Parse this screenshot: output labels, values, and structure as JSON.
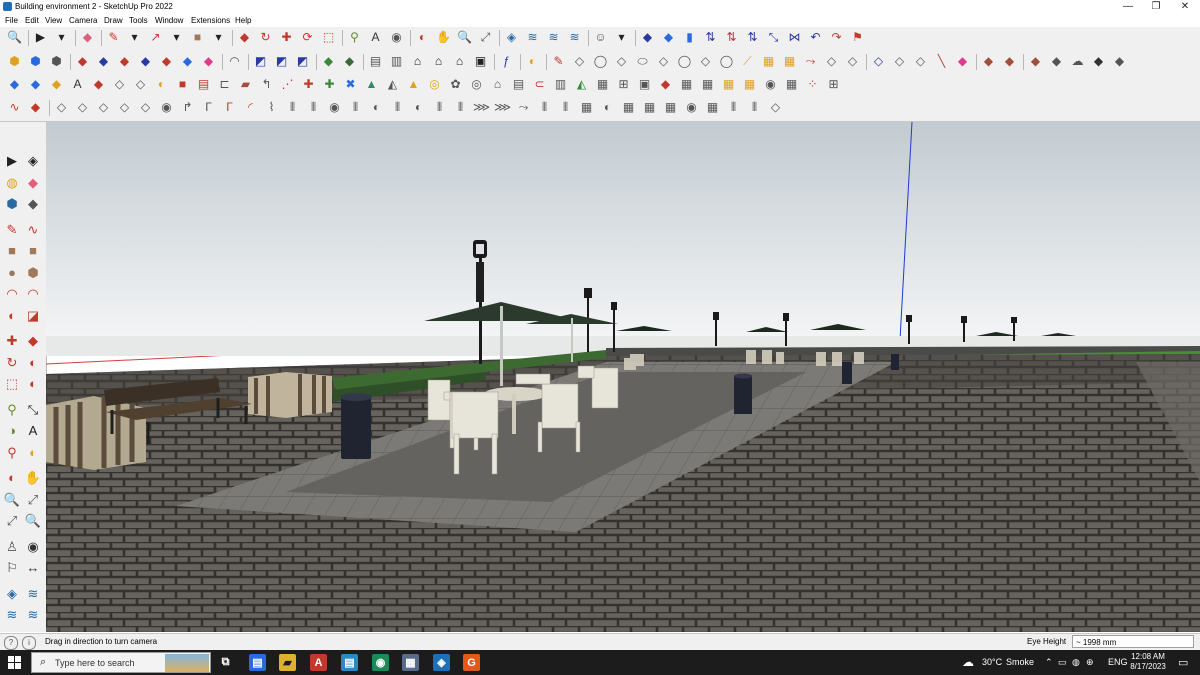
{
  "window": {
    "title": "Building environment 2 - SketchUp Pro 2022",
    "minimize": "—",
    "restore": "❐",
    "close": "✕"
  },
  "menu": [
    "File",
    "Edit",
    "View",
    "Camera",
    "Draw",
    "Tools",
    "Window",
    "Extensions",
    "Help"
  ],
  "status": {
    "hint": "Drag in direction to turn camera",
    "eye_height_label": "Eye Height",
    "eye_height_value": "~ 1998 mm"
  },
  "taskbar": {
    "search_placeholder": "Type here to search",
    "weather_temp": "30°C",
    "weather_desc": "Smoke",
    "lang": "ENG",
    "time": "12:08 AM",
    "date": "8/17/2023"
  },
  "toolbar_rows": [
    [
      {
        "glyph": "🔍",
        "color": "#3a3a3a"
      },
      {
        "sep": true
      },
      {
        "glyph": "▶",
        "color": "#222"
      },
      {
        "glyph": "▾",
        "color": "#222"
      },
      {
        "sep": true
      },
      {
        "glyph": "◆",
        "color": "#e0607a"
      },
      {
        "sep": true
      },
      {
        "glyph": "✎",
        "color": "#c83a2a"
      },
      {
        "glyph": "▾",
        "color": "#222"
      },
      {
        "glyph": "↗",
        "color": "#c83a2a"
      },
      {
        "glyph": "▾",
        "color": "#222"
      },
      {
        "glyph": "■",
        "color": "#a0785a"
      },
      {
        "glyph": "▾",
        "color": "#222"
      },
      {
        "sep": true
      },
      {
        "glyph": "◆",
        "color": "#c0392b"
      },
      {
        "glyph": "↻",
        "color": "#c0392b"
      },
      {
        "glyph": "✚",
        "color": "#c0392b"
      },
      {
        "glyph": "⟳",
        "color": "#c0392b"
      },
      {
        "glyph": "⬚",
        "color": "#c0392b"
      },
      {
        "sep": true
      },
      {
        "glyph": "⚲",
        "color": "#6a8a30"
      },
      {
        "glyph": "A",
        "color": "#333"
      },
      {
        "glyph": "◉",
        "color": "#555"
      },
      {
        "sep": true
      },
      {
        "glyph": "◐",
        "color": "#c0392b"
      },
      {
        "glyph": "✋",
        "color": "#555"
      },
      {
        "glyph": "🔍",
        "color": "#555"
      },
      {
        "glyph": "⤢",
        "color": "#555"
      },
      {
        "sep": true
      },
      {
        "glyph": "◈",
        "color": "#2a6aa0"
      },
      {
        "glyph": "≋",
        "color": "#2a6aa0"
      },
      {
        "glyph": "≋",
        "color": "#2a6aa0"
      },
      {
        "glyph": "≋",
        "color": "#2a6aa0"
      },
      {
        "sep": true
      },
      {
        "glyph": "☺",
        "color": "#555"
      },
      {
        "glyph": "▾",
        "color": "#222"
      },
      {
        "sep": true
      },
      {
        "glyph": "◆",
        "color": "#2a3aa0"
      },
      {
        "glyph": "◆",
        "color": "#2a6ae0"
      },
      {
        "glyph": "▮",
        "color": "#2a6ae0"
      },
      {
        "glyph": "⇅",
        "color": "#2a3aa0"
      },
      {
        "glyph": "⇅",
        "color": "#c0392b"
      },
      {
        "glyph": "⇅",
        "color": "#2a3aa0"
      },
      {
        "glyph": "⤡",
        "color": "#2a3aa0"
      },
      {
        "glyph": "⋈",
        "color": "#2a3aa0"
      },
      {
        "glyph": "↶",
        "color": "#2a3aa0"
      },
      {
        "glyph": "↷",
        "color": "#c0392b"
      },
      {
        "glyph": "⚑",
        "color": "#c0392b"
      }
    ],
    [
      {
        "glyph": "⬢",
        "color": "#e0a020"
      },
      {
        "glyph": "⬢",
        "color": "#2a6ae0"
      },
      {
        "glyph": "⬢",
        "color": "#555"
      },
      {
        "sep": true
      },
      {
        "glyph": "◆",
        "color": "#c0392b"
      },
      {
        "glyph": "◆",
        "color": "#2a3aa0"
      },
      {
        "glyph": "◆",
        "color": "#c0392b"
      },
      {
        "glyph": "◆",
        "color": "#2a3aa0"
      },
      {
        "glyph": "◆",
        "color": "#c0392b"
      },
      {
        "glyph": "◆",
        "color": "#2a6ae0"
      },
      {
        "glyph": "◆",
        "color": "#e03a8a"
      },
      {
        "sep": true
      },
      {
        "glyph": "◠",
        "color": "#555"
      },
      {
        "sep": true
      },
      {
        "glyph": "◩",
        "color": "#2a3aa0"
      },
      {
        "glyph": "◩",
        "color": "#2a3aa0"
      },
      {
        "glyph": "◩",
        "color": "#2a3aa0"
      },
      {
        "sep": true
      },
      {
        "glyph": "◆",
        "color": "#3a8a3a"
      },
      {
        "glyph": "◆",
        "color": "#3a6a3a"
      },
      {
        "sep": true
      },
      {
        "glyph": "▤",
        "color": "#555"
      },
      {
        "glyph": "▥",
        "color": "#555"
      },
      {
        "glyph": "⌂",
        "color": "#222"
      },
      {
        "glyph": "⌂",
        "color": "#222"
      },
      {
        "glyph": "⌂",
        "color": "#222"
      },
      {
        "glyph": "▣",
        "color": "#222"
      },
      {
        "sep": true
      },
      {
        "glyph": "ƒ",
        "color": "#2a3aa0"
      },
      {
        "sep": true
      },
      {
        "glyph": "◐",
        "color": "#e0a020"
      },
      {
        "sep": true
      },
      {
        "glyph": "✎",
        "color": "#c0392b"
      },
      {
        "glyph": "◇",
        "color": "#555"
      },
      {
        "glyph": "◯",
        "color": "#555"
      },
      {
        "glyph": "◇",
        "color": "#555"
      },
      {
        "glyph": "⬭",
        "color": "#555"
      },
      {
        "glyph": "◇",
        "color": "#555"
      },
      {
        "glyph": "◯",
        "color": "#555"
      },
      {
        "glyph": "◇",
        "color": "#555"
      },
      {
        "glyph": "◯",
        "color": "#555"
      },
      {
        "glyph": "⟋",
        "color": "#e0a020"
      },
      {
        "glyph": "▦",
        "color": "#e0a020"
      },
      {
        "glyph": "▦",
        "color": "#e0a020"
      },
      {
        "glyph": "⤳",
        "color": "#c0392b"
      },
      {
        "glyph": "◇",
        "color": "#555"
      },
      {
        "glyph": "◇",
        "color": "#555"
      },
      {
        "sep": true
      },
      {
        "glyph": "◇",
        "color": "#2a3aa0"
      },
      {
        "glyph": "◇",
        "color": "#555"
      },
      {
        "glyph": "◇",
        "color": "#555"
      },
      {
        "glyph": "╲",
        "color": "#c0392b"
      },
      {
        "glyph": "◆",
        "color": "#e03a8a"
      },
      {
        "sep": true
      },
      {
        "glyph": "◆",
        "color": "#a0503a"
      },
      {
        "glyph": "◆",
        "color": "#a0503a"
      },
      {
        "sep": true
      },
      {
        "glyph": "◆",
        "color": "#a0503a"
      },
      {
        "glyph": "◆",
        "color": "#555"
      },
      {
        "glyph": "☁",
        "color": "#555"
      },
      {
        "glyph": "◆",
        "color": "#333"
      },
      {
        "glyph": "◆",
        "color": "#555"
      }
    ],
    [
      {
        "glyph": "◆",
        "color": "#2a6ae0"
      },
      {
        "glyph": "◆",
        "color": "#2a6ae0"
      },
      {
        "glyph": "◆",
        "color": "#e0a020"
      },
      {
        "glyph": "A",
        "color": "#333"
      },
      {
        "glyph": "◆",
        "color": "#c0392b"
      },
      {
        "glyph": "◇",
        "color": "#555"
      },
      {
        "glyph": "◇",
        "color": "#555"
      },
      {
        "glyph": "◐",
        "color": "#e0a020"
      },
      {
        "glyph": "■",
        "color": "#c0392b"
      },
      {
        "glyph": "▤",
        "color": "#c0392b"
      },
      {
        "glyph": "⊏",
        "color": "#555"
      },
      {
        "glyph": "▰",
        "color": "#a0503a"
      },
      {
        "glyph": "↰",
        "color": "#555"
      },
      {
        "glyph": "⋰",
        "color": "#c0392b"
      },
      {
        "glyph": "✚",
        "color": "#c0392b"
      },
      {
        "glyph": "✚",
        "color": "#3a8a3a"
      },
      {
        "glyph": "✖",
        "color": "#2a6ae0"
      },
      {
        "glyph": "▲",
        "color": "#2a8a6a"
      },
      {
        "glyph": "◭",
        "color": "#555"
      },
      {
        "glyph": "▲",
        "color": "#e0a020"
      },
      {
        "glyph": "◎",
        "color": "#e0a020"
      },
      {
        "glyph": "✿",
        "color": "#555"
      },
      {
        "glyph": "◎",
        "color": "#555"
      },
      {
        "glyph": "⌂",
        "color": "#555"
      },
      {
        "glyph": "▤",
        "color": "#555"
      },
      {
        "glyph": "⊂",
        "color": "#c0392b"
      },
      {
        "glyph": "▥",
        "color": "#555"
      },
      {
        "glyph": "◭",
        "color": "#3a8a3a"
      },
      {
        "glyph": "▦",
        "color": "#555"
      },
      {
        "glyph": "⊞",
        "color": "#555"
      },
      {
        "glyph": "▣",
        "color": "#555"
      },
      {
        "glyph": "◆",
        "color": "#c0392b"
      },
      {
        "glyph": "▦",
        "color": "#555"
      },
      {
        "glyph": "▦",
        "color": "#555"
      },
      {
        "glyph": "▦",
        "color": "#e0a020"
      },
      {
        "glyph": "▦",
        "color": "#e0a020"
      },
      {
        "glyph": "◉",
        "color": "#555"
      },
      {
        "glyph": "▦",
        "color": "#555"
      },
      {
        "glyph": "⁘",
        "color": "#c0392b"
      },
      {
        "glyph": "⊞",
        "color": "#555"
      }
    ],
    [
      {
        "glyph": "∿",
        "color": "#c0392b"
      },
      {
        "glyph": "◆",
        "color": "#c0392b"
      },
      {
        "sep": true
      },
      {
        "glyph": "◇",
        "color": "#555"
      },
      {
        "glyph": "◇",
        "color": "#555"
      },
      {
        "glyph": "◇",
        "color": "#555"
      },
      {
        "glyph": "◇",
        "color": "#555"
      },
      {
        "glyph": "◇",
        "color": "#555"
      },
      {
        "glyph": "◉",
        "color": "#555"
      },
      {
        "glyph": "↱",
        "color": "#555"
      },
      {
        "glyph": "Γ",
        "color": "#555"
      },
      {
        "glyph": "Γ",
        "color": "#c0392b"
      },
      {
        "glyph": "◜",
        "color": "#c0392b"
      },
      {
        "glyph": "⌇",
        "color": "#555"
      },
      {
        "glyph": "⫴",
        "color": "#555"
      },
      {
        "glyph": "⫴",
        "color": "#555"
      },
      {
        "glyph": "◉",
        "color": "#555"
      },
      {
        "glyph": "⫴",
        "color": "#555"
      },
      {
        "glyph": "◐",
        "color": "#555"
      },
      {
        "glyph": "⫴",
        "color": "#555"
      },
      {
        "glyph": "◐",
        "color": "#555"
      },
      {
        "glyph": "⫴",
        "color": "#555"
      },
      {
        "glyph": "⫴",
        "color": "#555"
      },
      {
        "glyph": "⋙",
        "color": "#555"
      },
      {
        "glyph": "⋙",
        "color": "#555"
      },
      {
        "glyph": "⤳",
        "color": "#555"
      },
      {
        "glyph": "⫴",
        "color": "#555"
      },
      {
        "glyph": "⫴",
        "color": "#555"
      },
      {
        "glyph": "▦",
        "color": "#555"
      },
      {
        "glyph": "◐",
        "color": "#555"
      },
      {
        "glyph": "▦",
        "color": "#555"
      },
      {
        "glyph": "▦",
        "color": "#555"
      },
      {
        "glyph": "▦",
        "color": "#555"
      },
      {
        "glyph": "◉",
        "color": "#555"
      },
      {
        "glyph": "▦",
        "color": "#555"
      },
      {
        "glyph": "⫴",
        "color": "#555"
      },
      {
        "glyph": "⫴",
        "color": "#555"
      },
      {
        "glyph": "◇",
        "color": "#555"
      }
    ]
  ],
  "left_tools": [
    [
      {
        "glyph": "▶",
        "color": "#222"
      },
      {
        "glyph": "◈",
        "color": "#222"
      }
    ],
    [
      {
        "glyph": "◍",
        "color": "#e0a020"
      },
      {
        "glyph": "◆",
        "color": "#e0607a"
      }
    ],
    [
      {
        "glyph": "⬢",
        "color": "#2a6aa0"
      },
      {
        "glyph": "◆",
        "color": "#555"
      }
    ],
    [
      {
        "glyph": "✎",
        "color": "#c0392b"
      },
      {
        "glyph": "∿",
        "color": "#c0392b"
      }
    ],
    [
      {
        "glyph": "■",
        "color": "#a0785a"
      },
      {
        "glyph": "■",
        "color": "#a0785a"
      }
    ],
    [
      {
        "glyph": "●",
        "color": "#a0785a"
      },
      {
        "glyph": "⬢",
        "color": "#a0785a"
      }
    ],
    [
      {
        "glyph": "◠",
        "color": "#c0392b"
      },
      {
        "glyph": "◠",
        "color": "#c0392b"
      }
    ],
    [
      {
        "glyph": "◐",
        "color": "#c0392b"
      },
      {
        "glyph": "◪",
        "color": "#c0392b"
      }
    ],
    [
      {
        "glyph": "✚",
        "color": "#c0392b"
      },
      {
        "glyph": "◆",
        "color": "#c0392b"
      }
    ],
    [
      {
        "glyph": "↻",
        "color": "#c0392b"
      },
      {
        "glyph": "◐",
        "color": "#c0392b"
      }
    ],
    [
      {
        "glyph": "⬚",
        "color": "#c0392b"
      },
      {
        "glyph": "◐",
        "color": "#c0392b"
      }
    ],
    [
      {
        "glyph": "⚲",
        "color": "#6a8a30"
      },
      {
        "glyph": "⤡",
        "color": "#222"
      }
    ],
    [
      {
        "glyph": "◑",
        "color": "#6a8a30"
      },
      {
        "glyph": "A",
        "color": "#222"
      }
    ],
    [
      {
        "glyph": "⚲",
        "color": "#c0392b"
      },
      {
        "glyph": "◐",
        "color": "#e0a020"
      }
    ],
    [
      {
        "glyph": "◐",
        "color": "#c0392b"
      },
      {
        "glyph": "✋",
        "color": "#555"
      }
    ],
    [
      {
        "glyph": "🔍",
        "color": "#555"
      },
      {
        "glyph": "⤢",
        "color": "#555"
      }
    ],
    [
      {
        "glyph": "⤢",
        "color": "#555"
      },
      {
        "glyph": "🔍",
        "color": "#555"
      }
    ],
    [
      {
        "glyph": "♙",
        "color": "#555"
      },
      {
        "glyph": "◉",
        "color": "#333"
      }
    ],
    [
      {
        "glyph": "⚐",
        "color": "#333"
      },
      {
        "glyph": "↔",
        "color": "#333"
      }
    ],
    [
      {
        "glyph": "◈",
        "color": "#2a6aa0"
      },
      {
        "glyph": "≋",
        "color": "#2a6aa0"
      }
    ],
    [
      {
        "glyph": "≋",
        "color": "#2a6aa0"
      },
      {
        "glyph": "≋",
        "color": "#2a6aa0"
      }
    ]
  ],
  "taskbar_apps": [
    {
      "glyph": "⧉",
      "color": "#ffffff",
      "bg": "transparent"
    },
    {
      "glyph": "▤",
      "color": "#ffffff",
      "bg": "#2a6ae0"
    },
    {
      "glyph": "▰",
      "color": "#1c1c1c",
      "bg": "#e0b030"
    },
    {
      "glyph": "A",
      "color": "#ffffff",
      "bg": "#c0392b"
    },
    {
      "glyph": "▤",
      "color": "#ffffff",
      "bg": "#2a8ac0"
    },
    {
      "glyph": "◉",
      "color": "#ffffff",
      "bg": "#1a8a5a"
    },
    {
      "glyph": "▦",
      "color": "#ffffff",
      "bg": "#5a6a8a"
    },
    {
      "glyph": "◈",
      "color": "#ffffff",
      "bg": "#1d6fb8"
    },
    {
      "glyph": "G",
      "color": "#ffffff",
      "bg": "#e05a1a"
    }
  ],
  "tray_icons": [
    "☁",
    "⌃",
    "▭",
    "◍",
    "⊕"
  ],
  "colors": {
    "sky_top": "#c3ccd2",
    "sky_bottom": "#f4f5f6",
    "floor": "#5c5954",
    "floor_joints": "#3a3835",
    "plaza": "#7c7a76",
    "accent": "#1d6fb8"
  }
}
